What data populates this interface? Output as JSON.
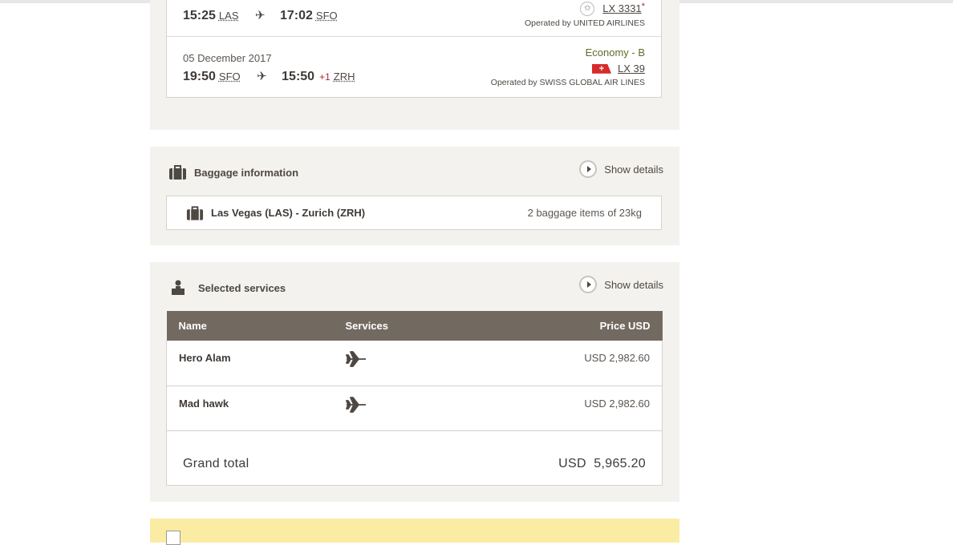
{
  "flight": {
    "seg1": {
      "dep_time": "15:25",
      "dep_airport": "LAS",
      "arr_time": "17:02",
      "arr_airport": "SFO",
      "flight_no": "LX 3331",
      "asterisk": "*",
      "operated_by": "Operated by UNITED AIRLINES"
    },
    "seg2": {
      "date": "05 December 2017",
      "dep_time": "19:50",
      "dep_airport": "SFO",
      "arr_time": "15:50",
      "day_offset": "+1",
      "arr_airport": "ZRH",
      "cabin": "Economy - B",
      "flight_no": "LX 39",
      "operated_by": "Operated by SWISS GLOBAL AIR LINES"
    }
  },
  "baggage": {
    "title": "Baggage information",
    "show_details": "Show details",
    "route": "Las Vegas (LAS) - Zurich (ZRH)",
    "count": "2 baggage items of 23kg"
  },
  "services": {
    "title": "Selected services",
    "show_details": "Show details",
    "columns": {
      "name": "Name",
      "services": "Services",
      "price": "Price USD"
    },
    "rows": [
      {
        "name": "Hero Alam",
        "price": "USD 2,982.60"
      },
      {
        "name": "Mad hawk",
        "price": "USD 2,982.60"
      }
    ],
    "grand_total_label": "Grand total",
    "grand_total_value": "USD  5,965.20"
  },
  "icons": {
    "plane": "airplane-icon",
    "baggage": "suitcase-icon",
    "services": "passenger-icon",
    "chevron": "chevron-right-icon",
    "star_alliance": "star-alliance-icon",
    "swiss": "swiss-flag-icon"
  },
  "colors": {
    "panel_bg": "#f4f2ee",
    "table_header": "#726960",
    "accent_red": "#b3262d",
    "cabin_green": "#5f6b2a",
    "notice_yellow": "#fbeca4"
  }
}
